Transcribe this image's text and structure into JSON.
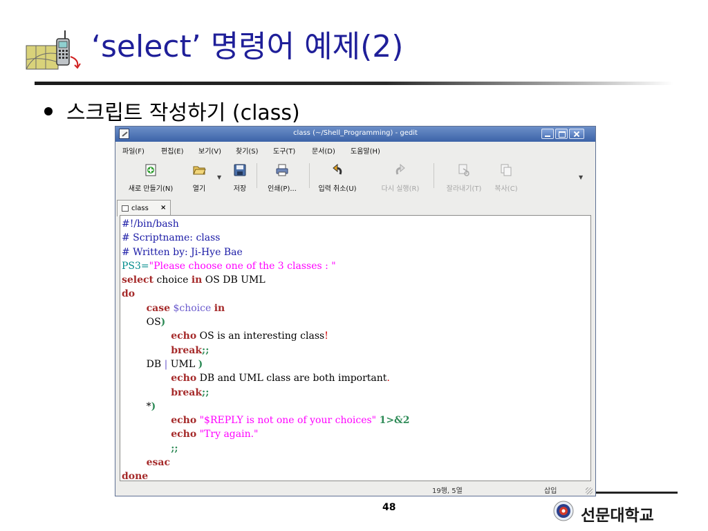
{
  "slide": {
    "title": "‘select’ 명령어 예제(2)",
    "bullet": "스크립트 작성하기 (class)",
    "page_number": "48",
    "logo_text": "선문대학교"
  },
  "window": {
    "title": "class (~/Shell_Programming) - gedit",
    "menu": [
      "파일(F)",
      "편집(E)",
      "보기(V)",
      "찾기(S)",
      "도구(T)",
      "문서(D)",
      "도움말(H)"
    ],
    "toolbar": {
      "new": "새로 만들기(N)",
      "open": "열기",
      "save": "저장",
      "print": "인쇄(P)...",
      "undo": "입력 취소(U)",
      "redo": "다시 실행(R)",
      "cut": "잘라내기(T)",
      "copy": "복사(C)"
    },
    "tab_label": "class",
    "status": {
      "position": "19행, 5열",
      "mode": "삽입"
    }
  },
  "code_lines": [
    "#!/bin/bash",
    "# Scriptname: class",
    "# Written by: Ji-Hye Bae",
    "PS3=\"Please choose one of the 3 classes : \"",
    "select choice in OS DB UML",
    "do",
    "        case $choice in",
    "        OS)",
    "                echo OS is an interesting class!",
    "                break;;",
    "        DB | UML )",
    "                echo DB and UML class are both important.",
    "                break;;",
    "        *)",
    "                echo \"$REPLY is not one of your choices\" 1>&2",
    "                echo \"Try again.\"",
    "                ;;",
    "        esac",
    "done"
  ],
  "colors": {
    "title": "#1f1f99",
    "keyword": "#a52a2a",
    "comment": "#1a1aa6",
    "string": "#ff00ff",
    "variable": "#6a5acd",
    "titlebar": "#4a6fb0"
  }
}
